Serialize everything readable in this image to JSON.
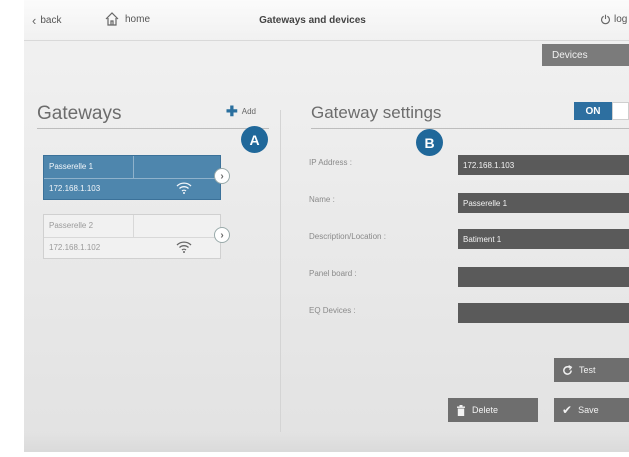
{
  "topbar": {
    "back_label": "back",
    "home_label": "home",
    "title": "Gateways and devices",
    "logout_label": "log"
  },
  "devices_button": "Devices",
  "gateways": {
    "heading": "Gateways",
    "add_label": "Add",
    "badge": "A",
    "items": [
      {
        "name": "Passerelle 1",
        "ip": "172.168.1.103",
        "selected": true
      },
      {
        "name": "Passerelle 2",
        "ip": "172.168.1.102",
        "selected": false
      }
    ]
  },
  "settings": {
    "heading": "Gateway settings",
    "badge": "B",
    "toggle_label": "ON",
    "fields": [
      {
        "label": "IP Address :",
        "value": "172.168.1.103"
      },
      {
        "label": "Name :",
        "value": "Passerelle 1"
      },
      {
        "label": "Description/Location :",
        "value": "Batiment 1"
      },
      {
        "label": "Panel board :",
        "value": ""
      },
      {
        "label": "EQ Devices :",
        "value": ""
      }
    ],
    "test_label": "Test",
    "delete_label": "Delete",
    "save_label": "Save"
  },
  "colors": {
    "accent": "#2d6fa0",
    "selected_card": "#4e86ad",
    "field_bg": "#5a5a5a",
    "button_bg": "#6e6e6e"
  }
}
